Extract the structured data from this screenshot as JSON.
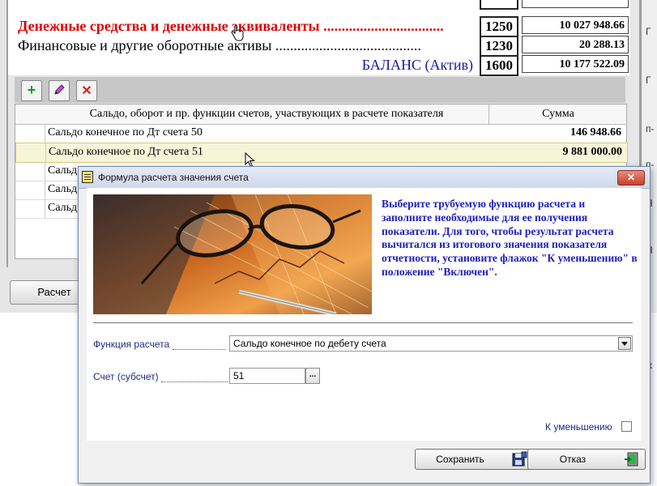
{
  "balance": {
    "rows": [
      {
        "label": "Денежные средства и денежные эквиваленты .................................",
        "code": "1250",
        "value": "10 027 948.66",
        "style": "red"
      },
      {
        "label": "Финансовые и другие оборотные активы ........................................",
        "code": "1230",
        "value": "20 288.13",
        "style": "normal"
      },
      {
        "label": "БАЛАНС (Актив)",
        "code": "1600",
        "value": "10 177 522.09",
        "style": "navy"
      }
    ]
  },
  "toolbar": {
    "add_icon": "plus-icon",
    "edit_icon": "pencil-icon",
    "delete_icon": "delete-icon"
  },
  "grid": {
    "headers": {
      "description": "Сальдо, оборот и пр. функции счетов, участвующих в расчете показателя",
      "amount": "Сумма"
    },
    "rows": [
      {
        "label": "Сальдо конечное по Дт счета 50",
        "value": "146 948.66"
      },
      {
        "label": "Сальдо конечное по Дт счета 51",
        "value": "9 881 000.00"
      },
      {
        "label": "Сальд",
        "value": ""
      },
      {
        "label": "Сальд",
        "value": ""
      },
      {
        "label": "Сальд",
        "value": ""
      }
    ]
  },
  "bg_buttons": {
    "calc_label": "Расчет"
  },
  "right_strip": {
    "chars": [
      "Г",
      "Г",
      "п-",
      "п-",
      "Я",
      "Я",
      "I",
      "I",
      "ж"
    ]
  },
  "dialog": {
    "title": "Формула расчета значения счета",
    "close_label": "✕",
    "info_text": "Выберите трубуемую  функцию расчета и заполните необходимые для ее получения показатели.    Для того, чтобы результат расчета вычитался из итогового значения показателя отчетности, установите флажок \"К уменьшению\" в положение \"Включен\".",
    "function_label": "Функция расчета",
    "function_value": "Сальдо конечное по дебету счета",
    "account_label": "Счет (субсчет)",
    "account_value": "51",
    "ellipsis_label": "...",
    "reduce_label": "К уменьшению",
    "reduce_checked": false,
    "save_label": "Сохранить",
    "cancel_label": "Отказ"
  },
  "colors": {
    "accent_blue": "#1e1ebe",
    "label_blue": "#1e2a8a",
    "red": "#e00000"
  }
}
